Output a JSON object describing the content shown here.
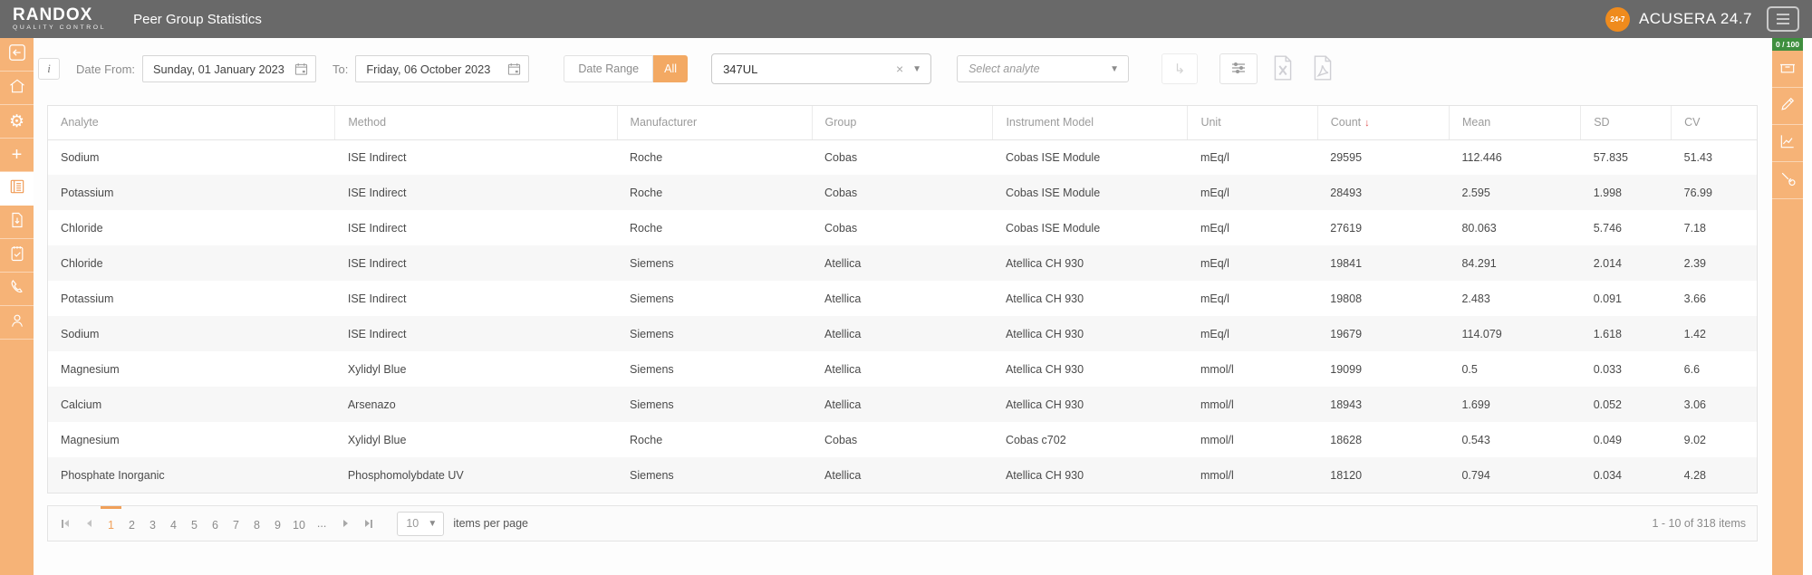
{
  "colors": {
    "header_bg": "#696969",
    "sidebar_orange": "#f6b377",
    "accent_orange": "#f0a05a",
    "brand_badge_orange": "#ef8b1d",
    "score_badge_green": "#3f8f3f",
    "sort_arrow_red": "#e05252"
  },
  "header": {
    "logo_line1": "RANDOX",
    "logo_line2": "QUALITY CONTROL",
    "title": "Peer Group Statistics",
    "badge_label": "24•7",
    "app_name": "ACUSERA 24.7"
  },
  "left_sidebar": {
    "items": [
      "back",
      "home",
      "settings",
      "add",
      "reports (active)",
      "document-download",
      "tasks",
      "phone",
      "user"
    ]
  },
  "right_sidebar": {
    "badge": "0 / 100",
    "items": [
      "tray",
      "edit",
      "chart",
      "tools"
    ]
  },
  "toolbar": {
    "info_label": "i",
    "date_from_label": "Date From:",
    "date_from_value": "Sunday, 01 January 2023",
    "to_label": "To:",
    "date_to_value": "Friday, 06 October 2023",
    "date_range_label": "Date Range",
    "date_range_all_label": "All",
    "lot_value": "347UL",
    "analyte_placeholder": "Select analyte"
  },
  "table": {
    "columns": [
      "Analyte",
      "Method",
      "Manufacturer",
      "Group",
      "Instrument Model",
      "Unit",
      "Count",
      "Mean",
      "SD",
      "CV"
    ],
    "sorted_column": "Count",
    "sort_direction": "desc",
    "rows": [
      [
        "Sodium",
        "ISE Indirect",
        "Roche",
        "Cobas",
        "Cobas ISE Module",
        "mEq/l",
        "29595",
        "112.446",
        "57.835",
        "51.43"
      ],
      [
        "Potassium",
        "ISE Indirect",
        "Roche",
        "Cobas",
        "Cobas ISE Module",
        "mEq/l",
        "28493",
        "2.595",
        "1.998",
        "76.99"
      ],
      [
        "Chloride",
        "ISE Indirect",
        "Roche",
        "Cobas",
        "Cobas ISE Module",
        "mEq/l",
        "27619",
        "80.063",
        "5.746",
        "7.18"
      ],
      [
        "Chloride",
        "ISE Indirect",
        "Siemens",
        "Atellica",
        "Atellica CH 930",
        "mEq/l",
        "19841",
        "84.291",
        "2.014",
        "2.39"
      ],
      [
        "Potassium",
        "ISE Indirect",
        "Siemens",
        "Atellica",
        "Atellica CH 930",
        "mEq/l",
        "19808",
        "2.483",
        "0.091",
        "3.66"
      ],
      [
        "Sodium",
        "ISE Indirect",
        "Siemens",
        "Atellica",
        "Atellica CH 930",
        "mEq/l",
        "19679",
        "114.079",
        "1.618",
        "1.42"
      ],
      [
        "Magnesium",
        "Xylidyl Blue",
        "Siemens",
        "Atellica",
        "Atellica CH 930",
        "mmol/l",
        "19099",
        "0.5",
        "0.033",
        "6.6"
      ],
      [
        "Calcium",
        "Arsenazo",
        "Siemens",
        "Atellica",
        "Atellica CH 930",
        "mmol/l",
        "18943",
        "1.699",
        "0.052",
        "3.06"
      ],
      [
        "Magnesium",
        "Xylidyl Blue",
        "Roche",
        "Cobas",
        "Cobas c702",
        "mmol/l",
        "18628",
        "0.543",
        "0.049",
        "9.02"
      ],
      [
        "Phosphate Inorganic",
        "Phosphomolybdate UV",
        "Siemens",
        "Atellica",
        "Atellica CH 930",
        "mmol/l",
        "18120",
        "0.794",
        "0.034",
        "4.28"
      ]
    ]
  },
  "pagination": {
    "pages": [
      "1",
      "2",
      "3",
      "4",
      "5",
      "6",
      "7",
      "8",
      "9",
      "10"
    ],
    "ellipsis": "...",
    "active_page": "1",
    "page_size": "10",
    "items_per_page_label": "items per page",
    "range_label": "1 - 10 of 318 items"
  }
}
